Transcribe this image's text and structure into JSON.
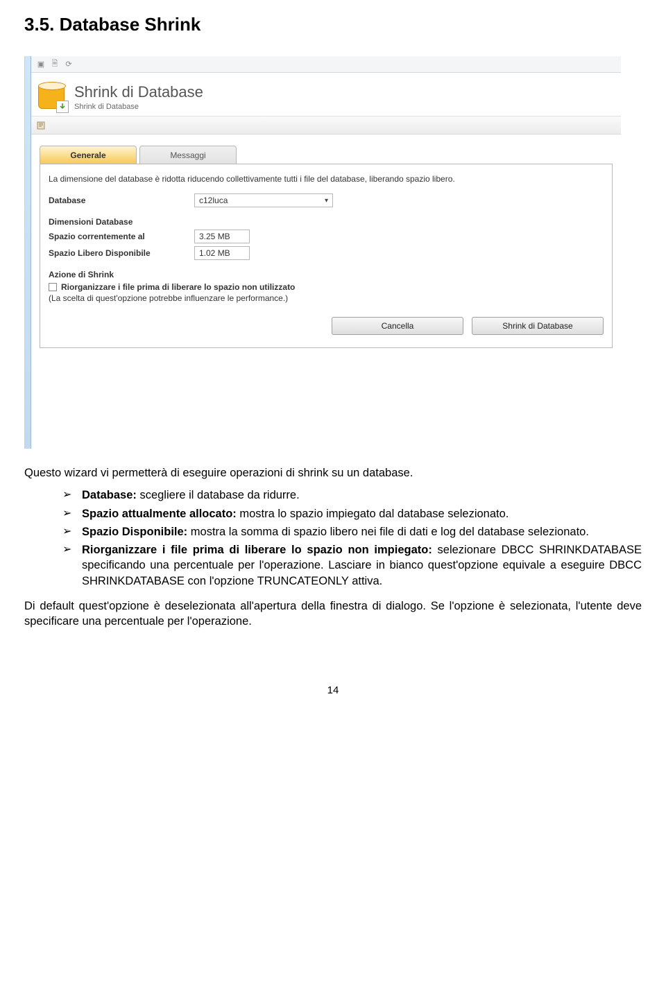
{
  "heading": "3.5. Database Shrink",
  "screenshot": {
    "big_title": "Shrink di Database",
    "small_title": "Shrink di Database",
    "tabs": {
      "generale": "Generale",
      "messaggi": "Messaggi"
    },
    "desc": "La dimensione del database è ridotta riducendo collettivamente tutti i file del database, liberando spazio libero.",
    "database_label": "Database",
    "database_value": "c12luca",
    "dim_section": "Dimensioni Database",
    "space_alloc_label": "Spazio correntemente al",
    "space_alloc_value": "3.25 MB",
    "space_free_label": "Spazio Libero Disponibile",
    "space_free_value": "1.02 MB",
    "action_section": "Azione di Shrink",
    "reorg_label": "Riorganizzare i file prima di liberare lo spazio non utilizzato",
    "reorg_hint": "(La scelta di quest'opzione potrebbe influenzare le performance.)",
    "btn_cancel": "Cancella",
    "btn_shrink": "Shrink di Database"
  },
  "body": {
    "intro": "Questo wizard vi permetterà di eseguire operazioni di shrink su un database.",
    "b1_label": "Database:",
    "b1_text": " scegliere il database da ridurre.",
    "b2_label": "Spazio attualmente allocato:",
    "b2_text": " mostra lo spazio impiegato dal database selezionato.",
    "b3_label": "Spazio Disponibile:",
    "b3_text": " mostra la somma di spazio libero nei file di dati e log del database selezionato.",
    "b4_label": "Riorganizzare i file prima di liberare lo spazio non impiegato:",
    "b4_text": " selezionare DBCC SHRINKDATABASE specificando una percentuale per l'operazione. Lasciare in bianco quest'opzione equivale a eseguire DBCC SHRINKDATABASE con l'opzione TRUNCATEONLY attiva.",
    "para2": "Di default quest'opzione è deselezionata all'apertura della finestra di dialogo. Se l'opzione è selezionata, l'utente deve specificare una percentuale per l'operazione.",
    "page_number": "14"
  }
}
